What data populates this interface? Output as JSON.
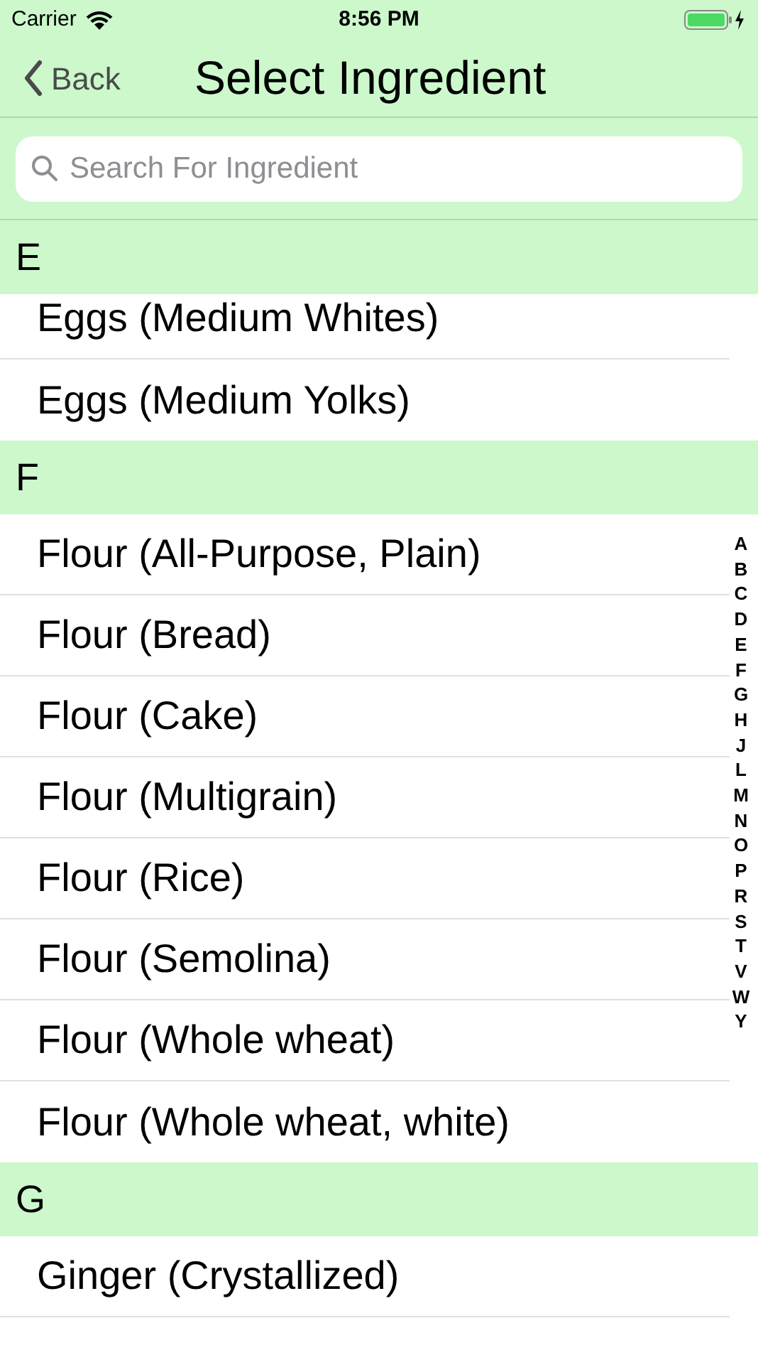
{
  "status_bar": {
    "carrier": "Carrier",
    "time": "8:56 PM"
  },
  "nav": {
    "back": "Back",
    "title": "Select Ingredient"
  },
  "search": {
    "placeholder": "Search For Ingredient"
  },
  "sections": [
    {
      "letter": "E",
      "items": [
        "Eggs (Medium Whites)",
        "Eggs (Medium Yolks)"
      ]
    },
    {
      "letter": "F",
      "items": [
        "Flour (All-Purpose, Plain)",
        "Flour (Bread)",
        "Flour (Cake)",
        "Flour (Multigrain)",
        "Flour (Rice)",
        "Flour (Semolina)",
        "Flour (Whole wheat)",
        "Flour (Whole wheat, white)"
      ]
    },
    {
      "letter": "G",
      "items": [
        "Ginger (Crystallized)"
      ],
      "continues": true
    }
  ],
  "index": [
    "A",
    "B",
    "C",
    "D",
    "E",
    "F",
    "G",
    "H",
    "J",
    "L",
    "M",
    "N",
    "O",
    "P",
    "R",
    "S",
    "T",
    "V",
    "W",
    "Y"
  ]
}
